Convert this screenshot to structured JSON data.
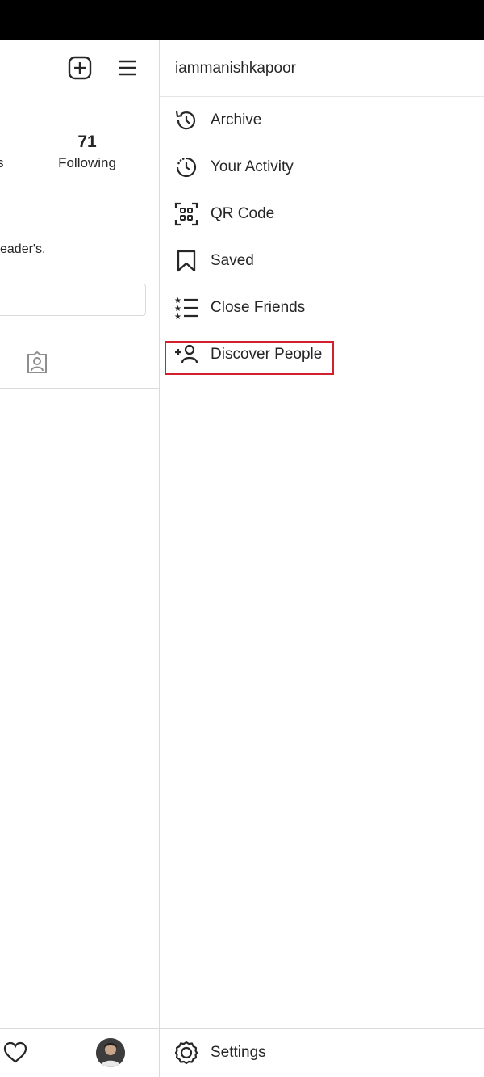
{
  "profile": {
    "following_count": "71",
    "following_label": "Following",
    "followers_label_fragment": "s",
    "bio_fragment": "eader's."
  },
  "drawer": {
    "username": "iammanishkapoor",
    "menu": [
      {
        "label": "Archive",
        "icon": "archive-icon"
      },
      {
        "label": "Your Activity",
        "icon": "activity-icon"
      },
      {
        "label": "QR Code",
        "icon": "qr-code-icon"
      },
      {
        "label": "Saved",
        "icon": "bookmark-icon"
      },
      {
        "label": "Close Friends",
        "icon": "close-friends-icon"
      },
      {
        "label": "Discover People",
        "icon": "add-person-icon"
      }
    ],
    "settings_label": "Settings"
  },
  "colors": {
    "highlight": "#d3202f",
    "text": "#262626",
    "divider": "#dbdbdb"
  }
}
